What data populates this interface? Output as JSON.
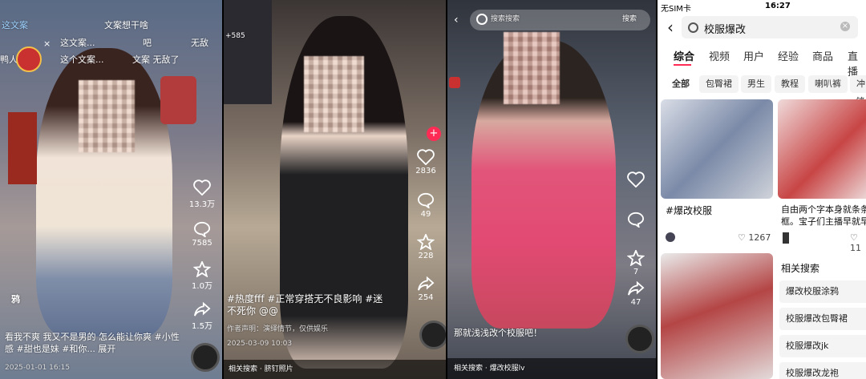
{
  "panel1": {
    "top_left_text": "这文案",
    "overlay_lines": [
      "文案想干啥",
      "这文案...",
      "这个文案..."
    ],
    "sticker_text": "吧",
    "sticker_text2": "无敌",
    "sticker_text3": "文案 无敌了",
    "live_label": "鸭人",
    "likes": "13.3万",
    "comments": "7585",
    "favorites": "1.0万",
    "shares": "1.5万",
    "author_tag": "鸦",
    "caption": "看我不爽 我又不是男的 怎么能让你爽 #小性感 #甜也是妹 #和你... 展开",
    "date": "2025-01-01 16:15"
  },
  "panel2": {
    "top_badge": "+585",
    "likes": "2836",
    "comments": "49",
    "favorites": "228",
    "shares": "254",
    "caption": "#热度fff #正常穿搭无不良影响 #迷不死你 @@",
    "notice": "作者声明：演绎情节，仅供娱乐",
    "date": "2025-03-09 10:03",
    "bottom_bar": "相关搜索 · 脐钉照片"
  },
  "panel3": {
    "search_placeholder": "搜索搜索",
    "search_button": "搜索",
    "likes": "7",
    "shares": "47",
    "caption": "那就浅浅改个校服吧！",
    "bottom_bar": "相关搜索 · 爆改校服lv"
  },
  "panel4": {
    "status_left": "无SIM卡",
    "status_time": "16:27",
    "search_query": "校服爆改",
    "tabs": [
      "综合",
      "视频",
      "用户",
      "经验",
      "商品",
      "直播"
    ],
    "chips": [
      "全部",
      "包臀裙",
      "男生",
      "教程",
      "喇叭裤",
      "冲锋"
    ],
    "card1_title": "#爆改校服",
    "card1_likes": "1267",
    "card2_title": "自由两个字本身就条条框。宝子们主播早就早",
    "card2_likes": "11",
    "related_title": "相关搜索",
    "related": [
      "爆改校服涂鸦",
      "校服爆改包臀裙",
      "校服爆改jk",
      "校服爆改龙袍"
    ]
  }
}
